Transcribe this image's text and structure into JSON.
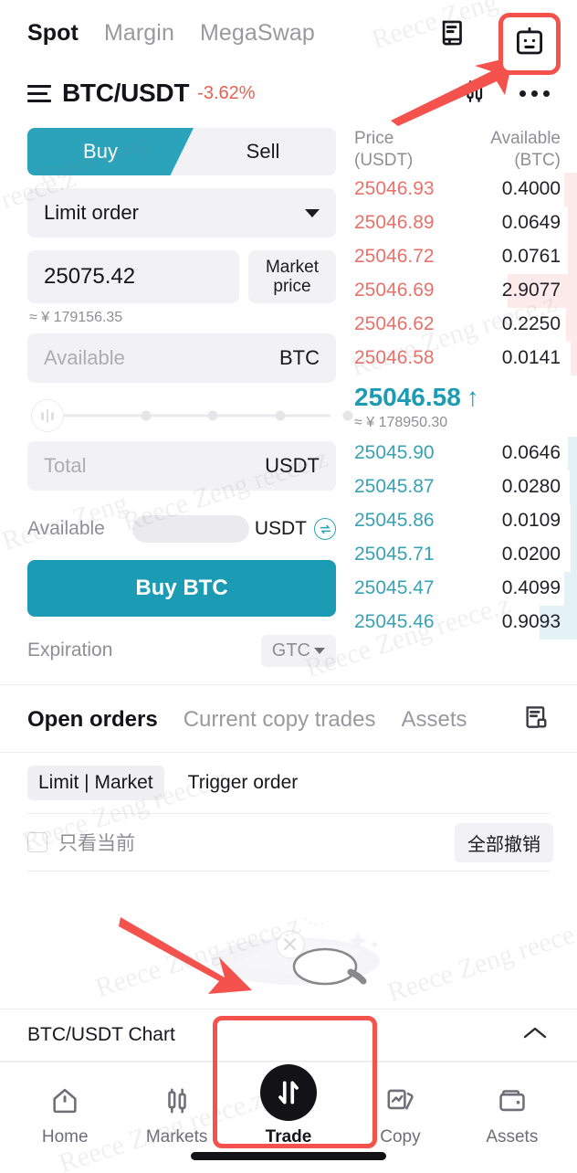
{
  "header": {
    "tabs": [
      {
        "label": "Spot",
        "active": true
      },
      {
        "label": "Margin",
        "active": false
      },
      {
        "label": "MegaSwap",
        "active": false
      }
    ],
    "icons": {
      "order_history": "order-history-icon",
      "bot": "robot-icon",
      "candles": "candlestick-icon",
      "more": "more-dots-icon"
    }
  },
  "pair": {
    "menu_icon": "hamburger-icon",
    "name": "BTC/USDT",
    "change": "-3.62%",
    "change_color": "#e8604f"
  },
  "order_form": {
    "side_tabs": [
      {
        "label": "Buy",
        "active": true
      },
      {
        "label": "Sell",
        "active": false
      }
    ],
    "order_type": "Limit order",
    "price_value": "25075.42",
    "market_price_label": "Market price",
    "price_approx": "≈ ¥ 179156.35",
    "amount_placeholder": "Available",
    "amount_unit": "BTC",
    "total_placeholder": "Total",
    "total_unit": "USDT",
    "slider_percent": 0,
    "slider_ticks": [
      25,
      50,
      75,
      100
    ],
    "available_label": "Available",
    "available_value": "",
    "available_unit": "USDT",
    "swap_icon": "swap-currency-icon",
    "submit_label": "Buy BTC",
    "submit_color": "#1c9cb4",
    "expiration_label": "Expiration",
    "expiration_value": "GTC"
  },
  "orderbook": {
    "col_price": "Price",
    "col_price_unit": "(USDT)",
    "col_amount": "Available",
    "col_amount_unit": "(BTC)",
    "asks": [
      {
        "price": "25046.93",
        "amount": "0.4000",
        "depth": 14
      },
      {
        "price": "25046.89",
        "amount": "0.0649",
        "depth": 8
      },
      {
        "price": "25046.72",
        "amount": "0.0761",
        "depth": 8
      },
      {
        "price": "25046.69",
        "amount": "2.9077",
        "depth": 100
      },
      {
        "price": "25046.62",
        "amount": "0.2250",
        "depth": 11
      },
      {
        "price": "25046.58",
        "amount": "0.0141",
        "depth": 4
      }
    ],
    "last_price": "25046.58",
    "last_direction": "↑",
    "last_approx": "≈ ¥ 178950.30",
    "bids": [
      {
        "price": "25045.90",
        "amount": "0.0646",
        "depth": 8
      },
      {
        "price": "25045.87",
        "amount": "0.0280",
        "depth": 5
      },
      {
        "price": "25045.86",
        "amount": "0.0109",
        "depth": 4
      },
      {
        "price": "25045.71",
        "amount": "0.0200",
        "depth": 4
      },
      {
        "price": "25045.47",
        "amount": "0.4099",
        "depth": 14
      },
      {
        "price": "25045.46",
        "amount": "0.9093",
        "depth": 52
      }
    ],
    "ask_color": "#e8726a",
    "bid_color": "#38a2b5"
  },
  "orders_panel": {
    "tabs": [
      {
        "label": "Open orders",
        "active": true
      },
      {
        "label": "Current copy trades",
        "active": false
      },
      {
        "label": "Assets",
        "active": false
      }
    ],
    "list_icon": "order-list-icon",
    "subtabs": [
      {
        "label": "Limit | Market",
        "active": true
      },
      {
        "label": "Trigger order",
        "active": false
      }
    ],
    "filter_checkbox_label": "只看当前",
    "filter_checked": false,
    "cancel_all_label": "全部撤销"
  },
  "chart_bar": {
    "label": "BTC/USDT  Chart",
    "expand_icon": "chevron-up-icon"
  },
  "bottom_nav": [
    {
      "label": "Home",
      "icon": "home-icon",
      "active": false
    },
    {
      "label": "Markets",
      "icon": "markets-candles-icon",
      "active": false
    },
    {
      "label": "Trade",
      "icon": "trade-swap-icon",
      "active": true
    },
    {
      "label": "Copy",
      "icon": "copy-cards-icon",
      "active": false
    },
    {
      "label": "Assets",
      "icon": "wallet-icon",
      "active": false
    }
  ],
  "annotations": {
    "highlight_color": "#f4534d",
    "boxes": [
      "robot-icon",
      "trade-nav-button"
    ],
    "arrows": [
      "arrow-to-robot-icon",
      "arrow-to-trade-button"
    ]
  },
  "watermarks": [
    "Reece Zeng",
    "reece.z",
    "Reece Zeng reece.z",
    "Reece Zeng",
    "reece.z"
  ]
}
